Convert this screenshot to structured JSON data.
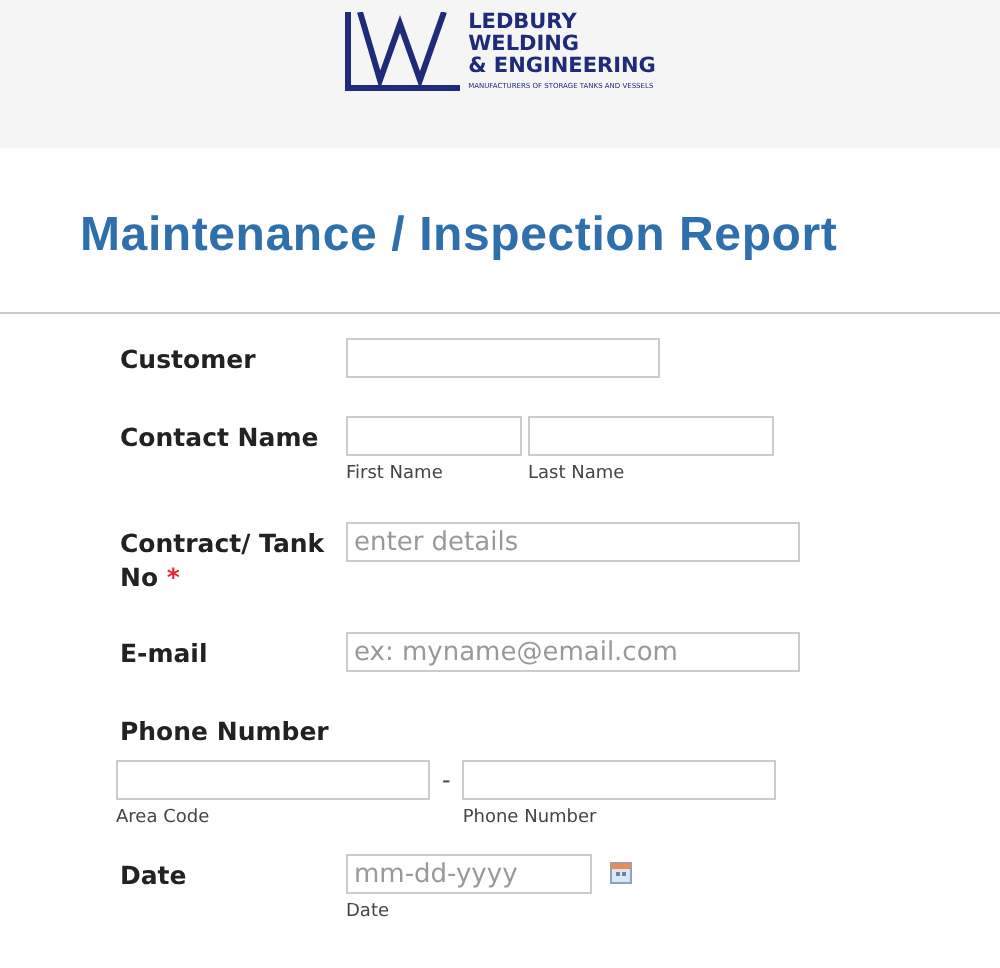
{
  "logo": {
    "lines": [
      "LEDBURY",
      "WELDING",
      "& ENGINEERING"
    ],
    "tagline": "MANUFACTURERS OF STORAGE TANKS AND VESSELS"
  },
  "title": "Maintenance / Inspection Report",
  "fields": [
    {
      "kind": "text",
      "label": "Customer"
    },
    {
      "kind": "name",
      "label": "Contact Name",
      "inputs": [
        {
          "sublabel": "First Name"
        },
        {
          "sublabel": "Last Name"
        }
      ]
    },
    {
      "kind": "text",
      "label": "Contract/ Tank No",
      "required_mark": "*",
      "inputs": [
        {
          "placeholder": "enter details"
        }
      ]
    },
    {
      "kind": "text",
      "label": "E-mail",
      "inputs": [
        {
          "placeholder": "ex: myname@email.com"
        }
      ]
    },
    {
      "kind": "phone",
      "label": "Phone Number",
      "separator": "-",
      "inputs": [
        {
          "sublabel": "Area Code"
        },
        {
          "sublabel": "Phone Number"
        }
      ]
    },
    {
      "kind": "date",
      "label": "Date",
      "inputs": [
        {
          "placeholder": "mm-dd-yyyy",
          "sublabel": "Date"
        }
      ]
    }
  ]
}
